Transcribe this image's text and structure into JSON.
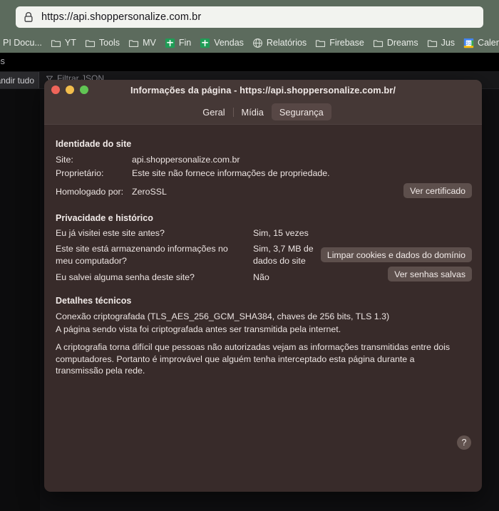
{
  "browser": {
    "url": "https://api.shoppersonalize.com.br",
    "lock_icon": "padlock-icon",
    "bookmarks": [
      {
        "label": "PI Docu...",
        "icon": "folder-icon"
      },
      {
        "label": "YT",
        "icon": "folder-icon"
      },
      {
        "label": "Tools",
        "icon": "folder-icon"
      },
      {
        "label": "MV",
        "icon": "folder-icon"
      },
      {
        "label": "Fin",
        "icon": "sheets-icon"
      },
      {
        "label": "Vendas",
        "icon": "sheets-icon"
      },
      {
        "label": "Relatórios",
        "icon": "globe-icon"
      },
      {
        "label": "Firebase",
        "icon": "folder-icon"
      },
      {
        "label": "Dreams",
        "icon": "folder-icon"
      },
      {
        "label": "Jus",
        "icon": "folder-icon"
      },
      {
        "label": "Calendar",
        "icon": "calendar-icon"
      }
    ]
  },
  "devtools": {
    "tab_label": "lhos",
    "expand_all_label": "andir tudo",
    "filter_placeholder": "Filtrar JSON",
    "filter_icon": "funnel-icon"
  },
  "dialog": {
    "title": "Informações da página - https://api.shoppersonalize.com.br/",
    "window_controls": [
      "close",
      "minimize",
      "zoom"
    ],
    "tabs": [
      {
        "label": "Geral",
        "active": false
      },
      {
        "label": "Mídia",
        "active": false
      },
      {
        "label": "Segurança",
        "active": true
      }
    ],
    "identity": {
      "heading": "Identidade do site",
      "site_label": "Site:",
      "site_value": "api.shoppersonalize.com.br",
      "owner_label": "Proprietário:",
      "owner_value": "Este site não fornece informações de propriedade.",
      "verified_label": "Homologado por:",
      "verified_value": "ZeroSSL",
      "view_cert_button": "Ver certificado"
    },
    "privacy": {
      "heading": "Privacidade e histórico",
      "visited_label": "Eu já visitei este site antes?",
      "visited_value": "Sim, 15 vezes",
      "storing_label": "Este site está armazenando informações no meu computador?",
      "storing_value": "Sim, 3,7 MB de dados do site",
      "clear_button": "Limpar cookies e dados do domínio",
      "password_label": "Eu salvei alguma senha deste site?",
      "password_value": "Não",
      "view_passwords_button": "Ver senhas salvas"
    },
    "technical": {
      "heading": "Detalhes técnicos",
      "line1": "Conexão criptografada (TLS_AES_256_GCM_SHA384, chaves de 256 bits, TLS 1.3)",
      "line2": "A página sendo vista foi criptografada antes ser transmitida pela internet.",
      "line3": "A criptografia torna difícil que pessoas não autorizadas vejam as informações transmitidas entre dois computadores. Portanto é improvável que alguém tenha interceptado esta página durante a transmissão pela rede."
    },
    "help_button": "?"
  },
  "colors": {
    "toolbar": "#5c6b5d",
    "dialog_body": "#382b2a",
    "dialog_titlebar": "#453836",
    "button": "#5d4f4c",
    "accent_green": "#61c554"
  }
}
